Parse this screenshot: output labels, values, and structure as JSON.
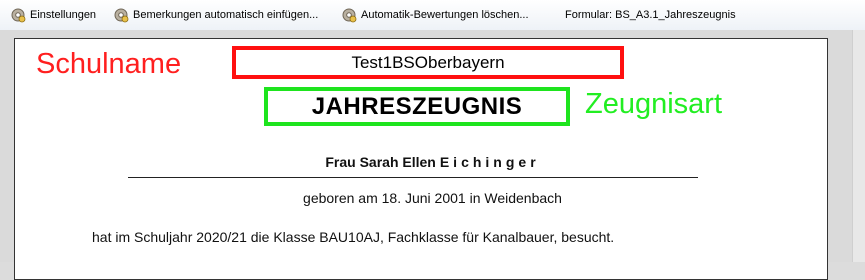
{
  "toolbar": {
    "items": [
      {
        "label": "Einstellungen",
        "icon": "gear-icon"
      },
      {
        "label": "Bemerkungen automatisch einfügen...",
        "icon": "gear-icon"
      },
      {
        "label": "Automatik-Bewertungen löschen...",
        "icon": "gear-icon"
      }
    ],
    "form_label": "Formular: BS_A3.1_Jahreszeugnis"
  },
  "annotations": {
    "school_name_label": "Schulname",
    "certificate_type_label": "Zeugnisart",
    "colors": {
      "school_name": "#ff1f1f",
      "certificate_type": "#22ee22"
    }
  },
  "document": {
    "school_name": "Test1BSOberbayern",
    "certificate_type": "JAHRESZEUGNIS",
    "student_given": "Frau Sarah Ellen",
    "student_surname": "Eichinger",
    "birth_line": "geboren am 18. Juni 2001 in Weidenbach",
    "school_year_line": "hat im Schuljahr 2020/21 die Klasse BAU10AJ, Fachklasse für Kanalbauer, besucht."
  }
}
